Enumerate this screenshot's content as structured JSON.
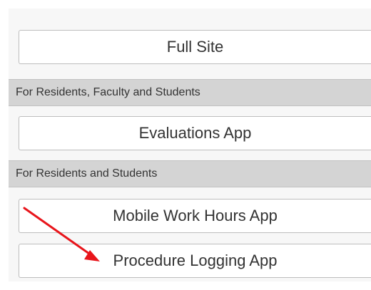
{
  "buttons": {
    "full_site": "Full Site",
    "evaluations_app": "Evaluations App",
    "mobile_work_hours_app": "Mobile Work Hours App",
    "procedure_logging_app": "Procedure Logging App"
  },
  "dividers": {
    "residents_faculty_students": "For Residents, Faculty and Students",
    "residents_students": "For Residents and Students"
  },
  "annotation": {
    "arrow_color": "#e8151b"
  },
  "colors": {
    "panel_bg": "#f7f7f7",
    "divider_bg": "#d4d4d4",
    "button_bg": "#ffffff",
    "button_border": "#bdbdbd",
    "text": "#333333"
  }
}
